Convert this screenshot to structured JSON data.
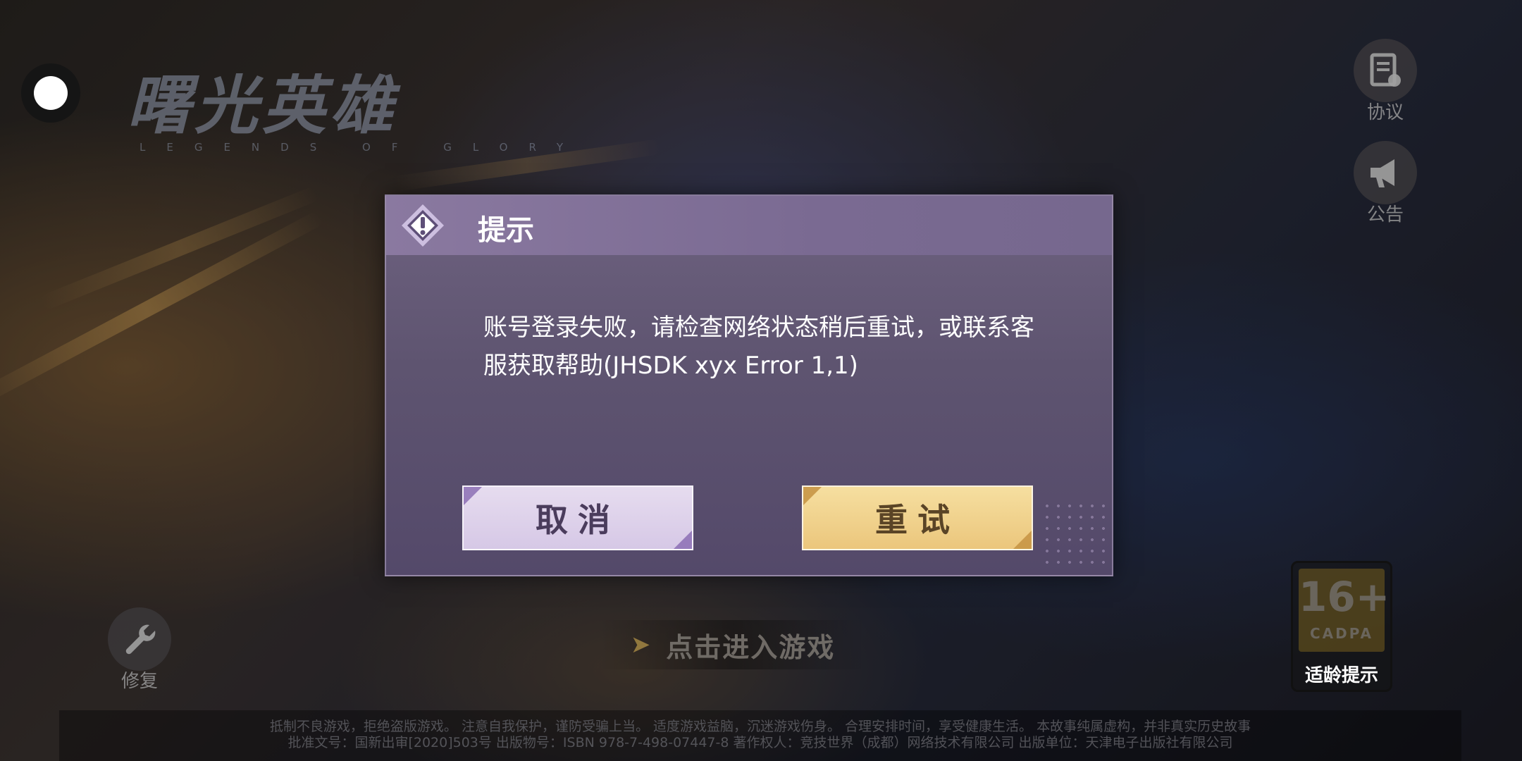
{
  "game": {
    "logo_title": "曙光英雄",
    "logo_subtitle": "LEGENDS OF GLORY"
  },
  "side_buttons": {
    "agreement_label": "协议",
    "notice_label": "公告",
    "repair_label": "修复"
  },
  "enter_game_label": "点击进入游戏",
  "footer": {
    "line1": "抵制不良游戏，拒绝盗版游戏。 注意自我保护，谨防受骗上当。 适度游戏益脑，沉迷游戏伤身。 合理安排时间，享受健康生活。 本故事纯属虚构，并非真实历史故事",
    "line2": "批准文号：国新出审[2020]503号 出版物号：ISBN 978-7-498-07447-8 著作权人：竞技世界（成都）网络技术有限公司 出版单位：天津电子出版社有限公司"
  },
  "age_rating": {
    "number": "16+",
    "org": "CADPA",
    "hint": "适龄提示"
  },
  "dialog": {
    "title": "提示",
    "message": "账号登录失败，请检查网络状态稍后重试，或联系客服获取帮助(JHSDK xyx Error 1,1)",
    "cancel_label": "取消",
    "retry_label": "重试"
  },
  "colors": {
    "dialog_header": "#8a79a0",
    "cancel_button": "#e6dcef",
    "retry_button": "#f6dfa0"
  }
}
